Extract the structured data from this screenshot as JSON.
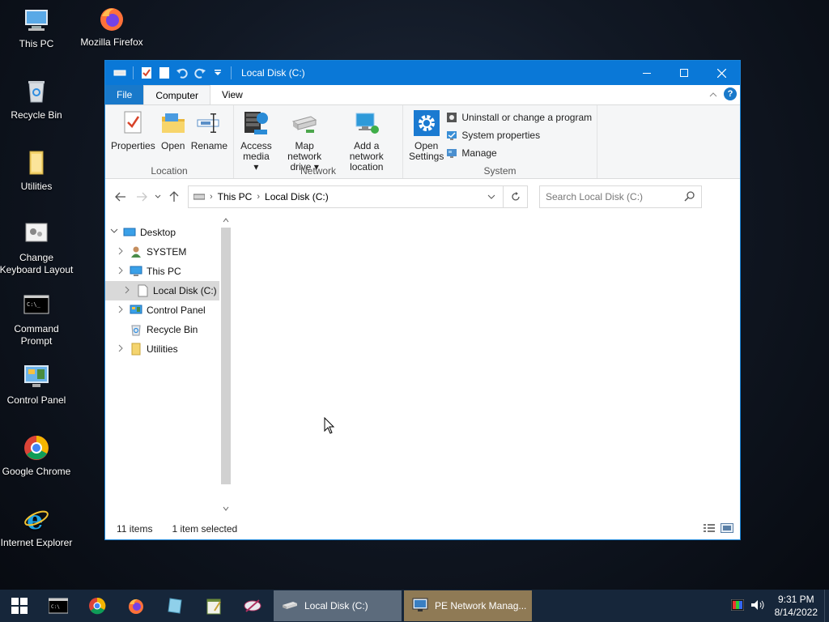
{
  "desktop": {
    "icons": [
      {
        "label": "This PC"
      },
      {
        "label": "Mozilla Firefox"
      },
      {
        "label": "Recycle Bin"
      },
      {
        "label": "Utilities"
      },
      {
        "label": "Change Keyboard Layout"
      },
      {
        "label": "Command Prompt"
      },
      {
        "label": "Control Panel"
      },
      {
        "label": "Google Chrome"
      },
      {
        "label": "Internet Explorer"
      }
    ]
  },
  "window": {
    "title": "Local Disk (C:)",
    "ribbon_tabs": [
      "File",
      "Computer",
      "View"
    ],
    "active_tab": "Computer",
    "ribbon": {
      "location": {
        "label": "Location",
        "properties": "Properties",
        "open": "Open",
        "rename": "Rename"
      },
      "network": {
        "label": "Network",
        "access_media_1": "Access",
        "access_media_2": "media",
        "map_drive_1": "Map network",
        "map_drive_2": "drive",
        "add_location_1": "Add a network",
        "add_location_2": "location"
      },
      "system": {
        "label": "System",
        "open_settings_1": "Open",
        "open_settings_2": "Settings",
        "uninstall": "Uninstall or change a program",
        "sys_props": "System properties",
        "manage": "Manage"
      }
    },
    "address": {
      "crumbs": [
        "This PC",
        "Local Disk (C:)"
      ]
    },
    "search": {
      "placeholder": "Search Local Disk (C:)"
    },
    "tree": [
      {
        "label": "Desktop"
      },
      {
        "label": "SYSTEM"
      },
      {
        "label": "This PC"
      },
      {
        "label": "Local Disk (C:)"
      },
      {
        "label": "Control Panel"
      },
      {
        "label": "Recycle Bin"
      },
      {
        "label": "Utilities"
      }
    ],
    "status": {
      "items": "11 items",
      "selected": "1 item selected"
    }
  },
  "taskbar": {
    "tasks": [
      {
        "label": "Local Disk (C:)"
      },
      {
        "label": "PE Network Manag..."
      }
    ],
    "clock": {
      "time": "9:31 PM",
      "date": "8/14/2022"
    }
  }
}
